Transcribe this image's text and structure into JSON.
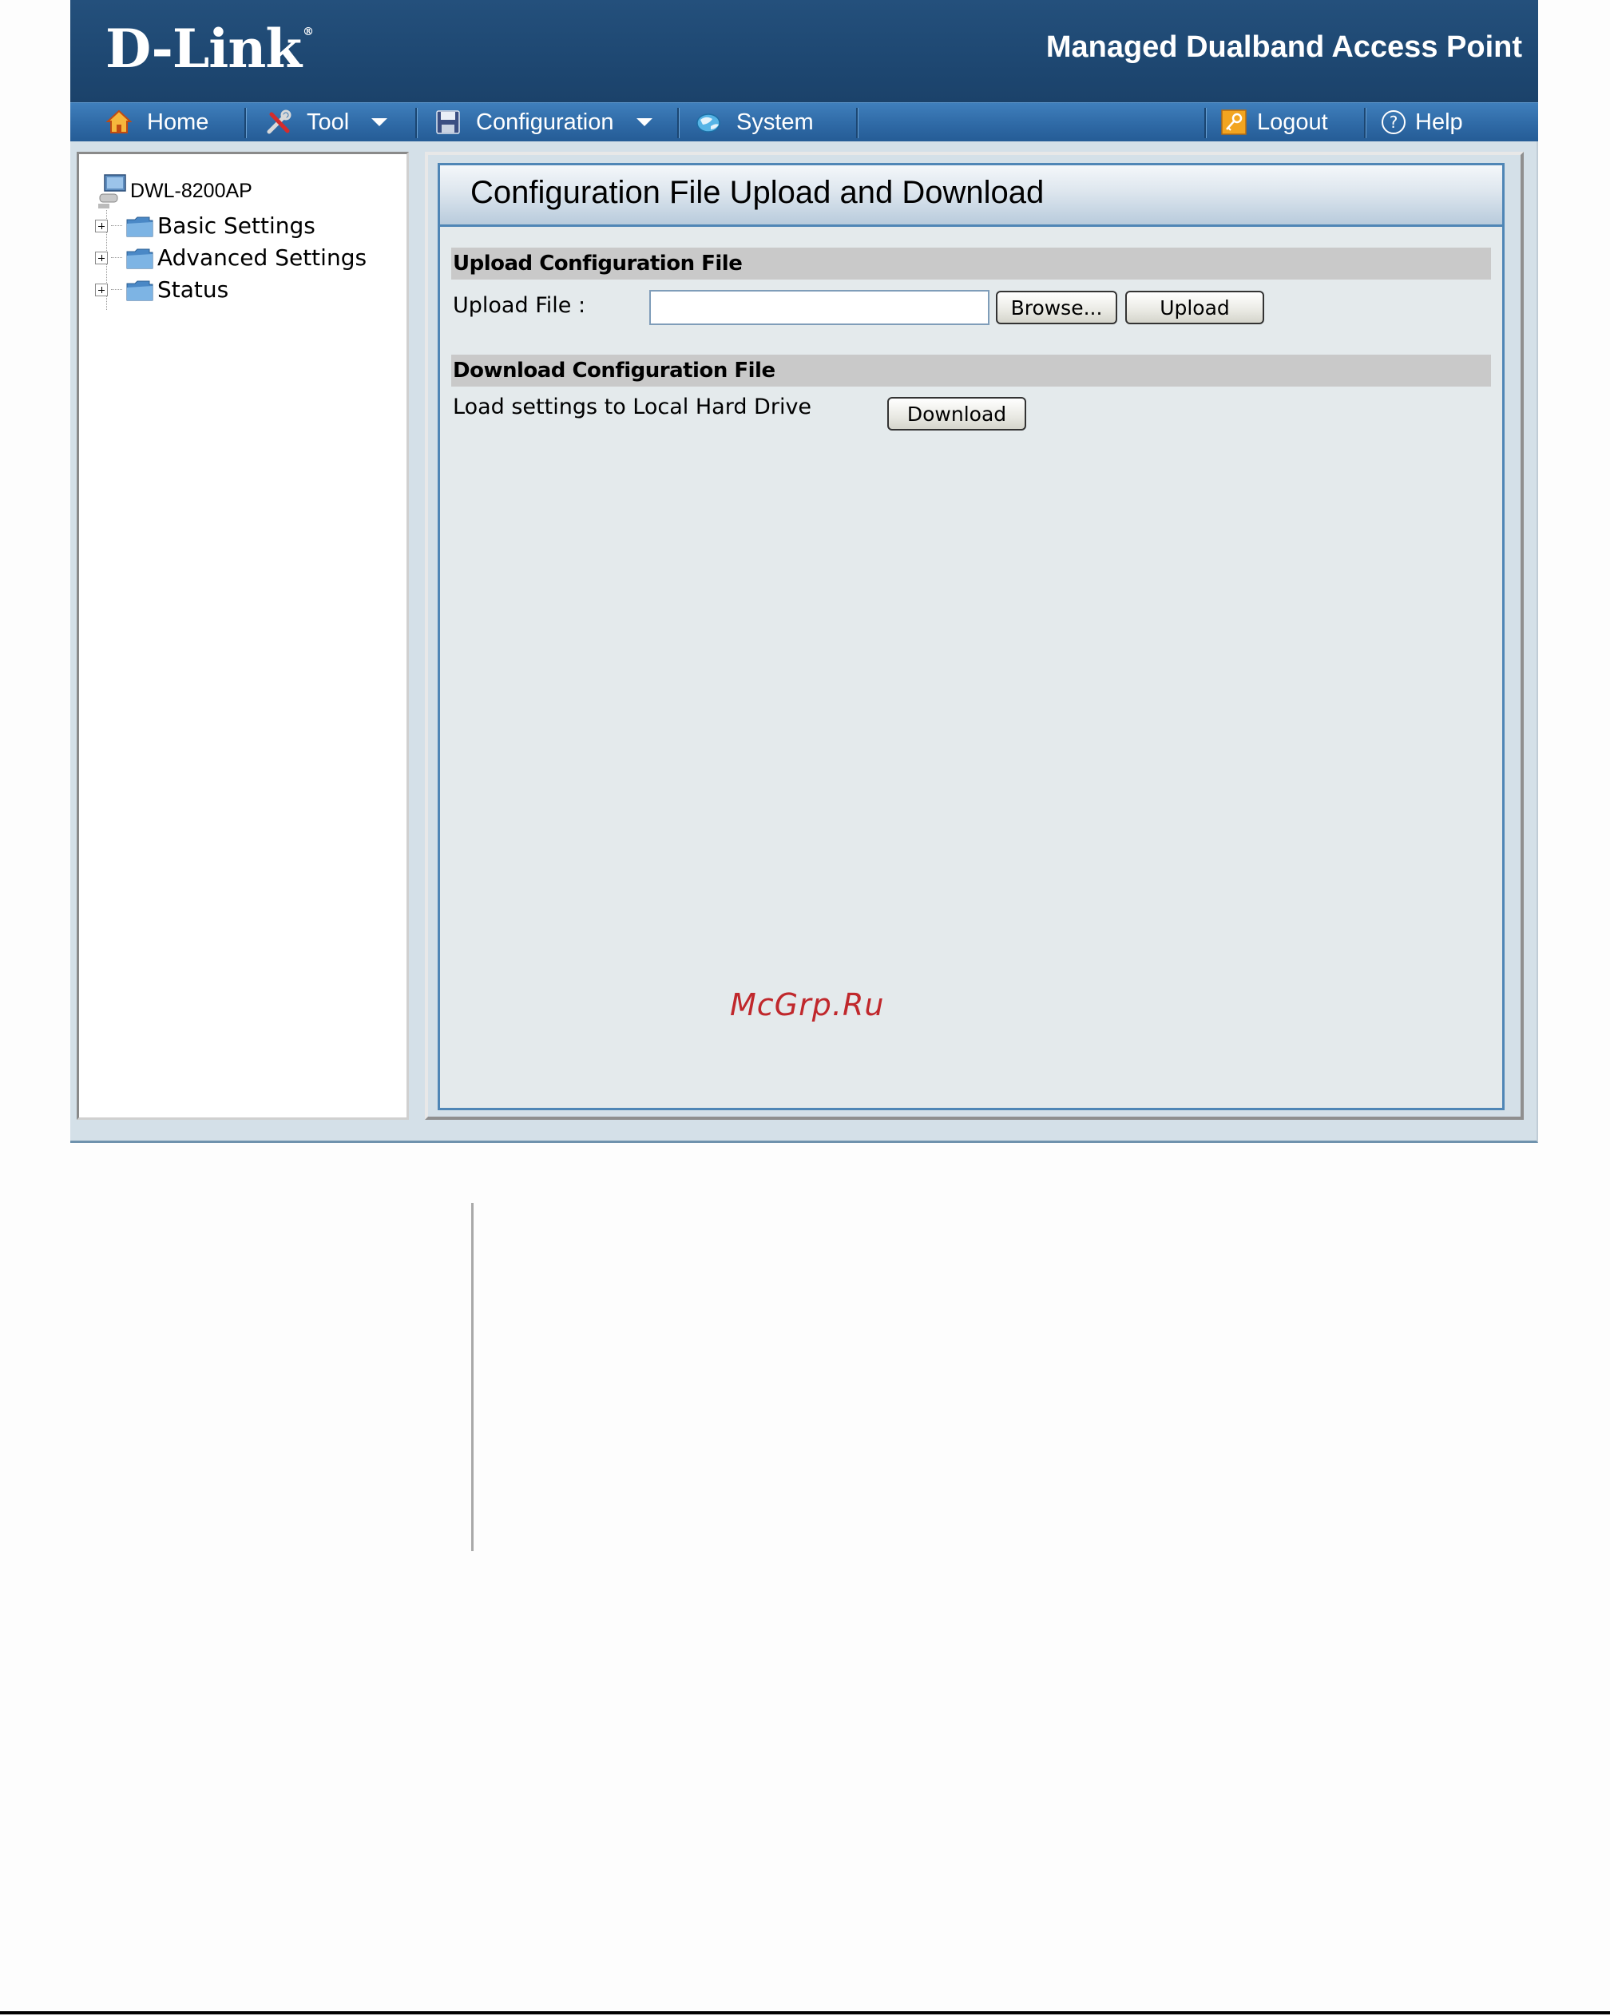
{
  "header": {
    "logo_text": "D-Link",
    "logo_mark": "®",
    "product_title": "Managed Dualband Access Point"
  },
  "nav": {
    "home": "Home",
    "tool": "Tool",
    "configuration": "Configuration",
    "system": "System",
    "logout": "Logout",
    "help": "Help"
  },
  "sidebar": {
    "root": "DWL-8200AP",
    "items": [
      {
        "label": "Basic Settings"
      },
      {
        "label": "Advanced Settings"
      },
      {
        "label": "Status"
      }
    ]
  },
  "panel": {
    "title": "Configuration File Upload and Download",
    "upload_section": "Upload Configuration File",
    "upload_label": "Upload File :",
    "upload_value": "",
    "browse_label": "Browse...",
    "upload_button": "Upload",
    "download_section": "Download Configuration File",
    "download_label": "Load settings to Local Hard Drive",
    "download_button": "Download"
  },
  "watermark": "McGrp.Ru",
  "colors": {
    "header_bg": "#1d4670",
    "nav_bg": "#2f6aa6",
    "panel_border": "#4f86b6",
    "watermark": "#c0282c"
  },
  "icons": {
    "home": "home-icon",
    "tool": "tools-icon",
    "configuration": "floppy-disk-icon",
    "system": "globe-icon",
    "logout": "key-icon",
    "help": "help-icon"
  }
}
